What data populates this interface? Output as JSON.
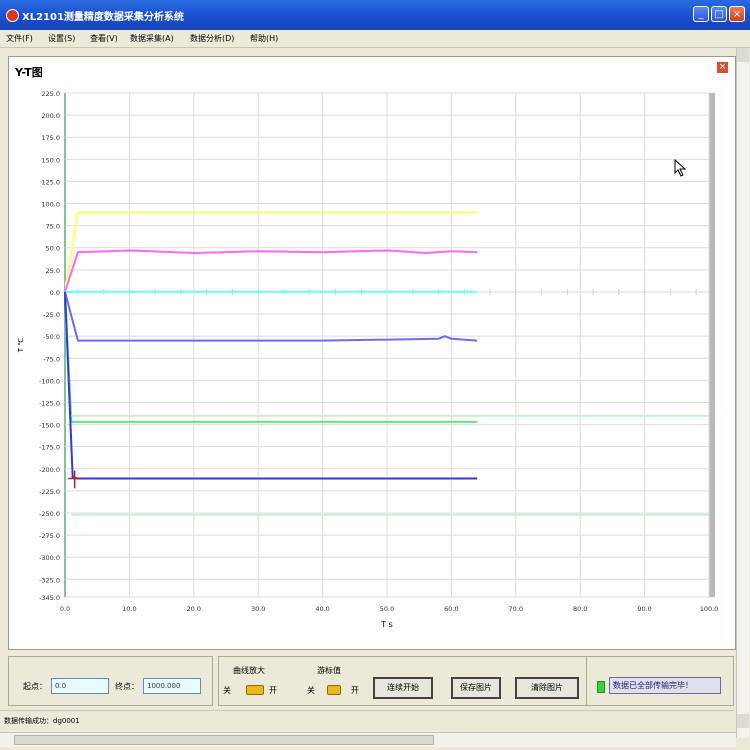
{
  "window": {
    "title": "XL2101测量精度数据采集分析系统",
    "btn_min": "_",
    "btn_max": "□",
    "btn_close": "×"
  },
  "menu": [
    {
      "label": "文件(F)"
    },
    {
      "label": "设置(S)"
    },
    {
      "label": "查看(V)"
    },
    {
      "label": "数据采集(A)"
    },
    {
      "label": "数据分析(D)"
    },
    {
      "label": "帮助(H)"
    }
  ],
  "panel": {
    "title": "Y-T图",
    "close": "×"
  },
  "chart_data": {
    "type": "line",
    "title": "",
    "xlabel": "T s",
    "ylabel": "T ℃",
    "xlim": [
      0,
      100
    ],
    "ylim": [
      -345,
      225
    ],
    "x_ticks": [
      "0.0",
      "10.0",
      "20.0",
      "30.0",
      "40.0",
      "50.0",
      "60.0",
      "70.0",
      "80.0",
      "90.0",
      "100.0"
    ],
    "y_ticks": [
      "225.0",
      "200.0",
      "175.0",
      "150.0",
      "125.0",
      "100.0",
      "75.0",
      "50.0",
      "25.0",
      "0.0",
      "-25.0",
      "-50.0",
      "-75.0",
      "-100.0",
      "-125.0",
      "-150.0",
      "-175.0",
      "-200.0",
      "-225.0",
      "-250.0",
      "-275.0",
      "-300.0",
      "-325.0",
      "-345.0"
    ],
    "grid": true,
    "series": [
      {
        "color": "#ffff66",
        "x": [
          0,
          2,
          64
        ],
        "y": [
          0,
          90,
          90
        ]
      },
      {
        "color": "#ff66ff",
        "x": [
          0,
          2,
          10,
          20,
          30,
          40,
          50,
          56,
          60,
          64
        ],
        "y": [
          0,
          45,
          47,
          44,
          46,
          45,
          47,
          44,
          46,
          45
        ]
      },
      {
        "color": "#66ffff",
        "x": [
          0,
          64
        ],
        "y": [
          0,
          0
        ]
      },
      {
        "color": "#6a6cf0",
        "x": [
          0,
          2,
          20,
          40,
          58,
          59,
          60,
          64
        ],
        "y": [
          0,
          -55,
          -55,
          -55,
          -53,
          -50,
          -53,
          -55
        ]
      },
      {
        "color": "#66e08a",
        "x": [
          0,
          1,
          64
        ],
        "y": [
          0,
          -147,
          -147
        ]
      },
      {
        "color": "#3636e0",
        "x": [
          0,
          1.2,
          2,
          64
        ],
        "y": [
          0,
          -210,
          -211,
          -211
        ]
      },
      {
        "color": "#c9f0cc",
        "x": [
          1,
          100
        ],
        "y": [
          -140,
          -140
        ]
      },
      {
        "color": "#c9f0cc",
        "x": [
          1,
          100
        ],
        "y": [
          -252,
          -252
        ]
      }
    ]
  },
  "controls": {
    "start_label": "起点：",
    "start_value": "0.0",
    "end_label": "终点：",
    "end_value": "1000.000",
    "scale_label": "曲线放大",
    "scale_off": "关",
    "scale_on": "开",
    "cursor_label": "游标值",
    "cursor_off": "关",
    "cursor_on": "开",
    "btn_continue": "连续开始",
    "btn_save": "保存图片",
    "btn_clear": "清除图片",
    "status_message": "数据已全部传输完毕！"
  },
  "statusbar": {
    "text": "数据传输成功：dg0001"
  }
}
